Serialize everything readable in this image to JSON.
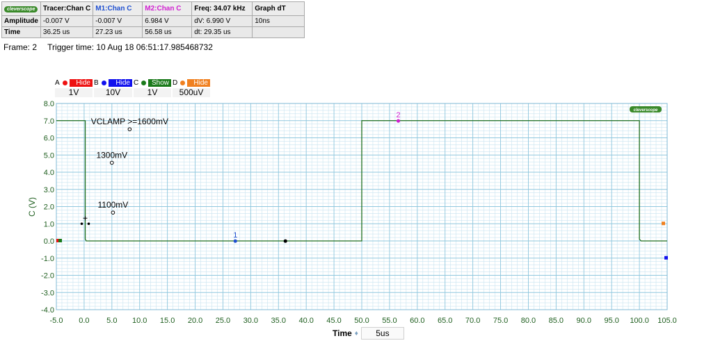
{
  "readout": {
    "logo": "cleverscope",
    "headers": [
      "Tracer:Chan C",
      "M1:Chan C",
      "M2:Chan C",
      "Freq: 34.07 kHz",
      "Graph dT"
    ],
    "header_colors": [
      "#000000",
      "#2050d0",
      "#d020d0",
      "#000000",
      "#000000"
    ],
    "rows": [
      {
        "label": "Amplitude",
        "cells": [
          "-0.007 V",
          "-0.007 V",
          "6.984 V",
          "dV: 6.990 V",
          "10ns"
        ]
      },
      {
        "label": "Time",
        "cells": [
          "36.25 us",
          "27.23 us",
          "56.58 us",
          "dt:  29.35 us",
          ""
        ]
      }
    ]
  },
  "frame": {
    "frame_text": "Frame: 2",
    "trigger_text": "Trigger time: 10 Aug 18 06:51:17.985468732"
  },
  "channels": [
    {
      "letter": "A",
      "state": "Hide",
      "scale": "1V",
      "color": "#ee1111"
    },
    {
      "letter": "B",
      "state": "Hide",
      "scale": "10V",
      "color": "#1111ee"
    },
    {
      "letter": "C",
      "state": "Show",
      "scale": "1V",
      "color": "#1a7a1a"
    },
    {
      "letter": "D",
      "state": "Hide",
      "scale": "500uV",
      "color": "#f08020"
    }
  ],
  "time_control": {
    "label": "Time",
    "value": "5us"
  },
  "chart_data": {
    "type": "line",
    "ylabel": "C (V)",
    "xlabel": "Time",
    "xlim": [
      -5,
      105
    ],
    "ylim": [
      -4,
      8
    ],
    "x_ticks": [
      -5,
      0,
      5,
      10,
      15,
      20,
      25,
      30,
      35,
      40,
      45,
      50,
      55,
      60,
      65,
      70,
      75,
      80,
      85,
      90,
      95,
      100,
      105
    ],
    "x_tick_labels": [
      "-5.0",
      "0.0",
      "5.0",
      "10.0",
      "15.0",
      "20.0",
      "25.0",
      "30.0",
      "35.0",
      "40.0",
      "45.0",
      "50.0",
      "55.0",
      "60.0",
      "65.0",
      "70.0",
      "75.0",
      "80.0",
      "85.0",
      "90.0",
      "95.0",
      "100.0",
      "105.0"
    ],
    "y_ticks": [
      -4,
      -3,
      -2,
      -1,
      0,
      1,
      2,
      3,
      4,
      5,
      6,
      7,
      8
    ],
    "y_tick_labels": [
      "-4.0",
      "-3.0",
      "-2.0",
      "-1.0",
      "0.0",
      "1.0",
      "2.0",
      "3.0",
      "4.0",
      "5.0",
      "6.0",
      "7.0",
      "8.0"
    ],
    "grid": true,
    "series": [
      {
        "color": "#1e6e1e",
        "x": [
          -5,
          0.2,
          0.2,
          0.4,
          50,
          50,
          100,
          100,
          100.3,
          105
        ],
        "y": [
          7,
          7,
          0.1,
          0,
          0,
          7,
          7,
          0.1,
          0,
          0
        ]
      }
    ],
    "annotations": [
      {
        "text": "VCLAMP >=1600mV",
        "x": 8.2,
        "y": 6.5
      },
      {
        "text": "1300mV",
        "x": 5,
        "y": 4.55
      },
      {
        "text": "1100mV",
        "x": 5.2,
        "y": 1.65
      }
    ],
    "markers": [
      {
        "label": "1",
        "x": 27.23,
        "y": -0.007,
        "color": "#2050d0"
      },
      {
        "label": "2",
        "x": 56.58,
        "y": 6.984,
        "color": "#d020d0"
      }
    ],
    "tracer": {
      "x": 36.25,
      "y": -0.007
    },
    "logo": "cleverscope",
    "colors": {
      "grid_major": "#8fc7de",
      "grid_minor": "#c9e4f0",
      "axis_text": "#1e5e1e"
    }
  }
}
